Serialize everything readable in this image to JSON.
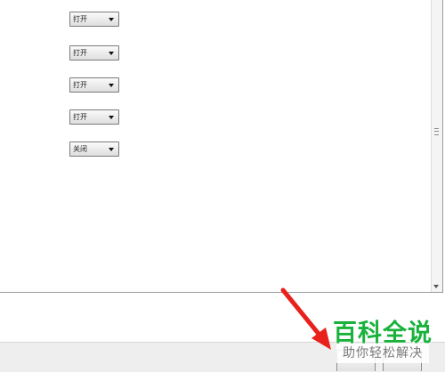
{
  "settings": {
    "dropdowns": [
      {
        "value": "打开"
      },
      {
        "value": "打开"
      },
      {
        "value": "打开"
      },
      {
        "value": "打开"
      },
      {
        "value": "关闭"
      }
    ]
  },
  "watermark": {
    "title": "百科全说",
    "subtitle": "助你轻松解决"
  },
  "colors": {
    "arrow": "#e8211c",
    "watermark_green": "#19b23b"
  }
}
